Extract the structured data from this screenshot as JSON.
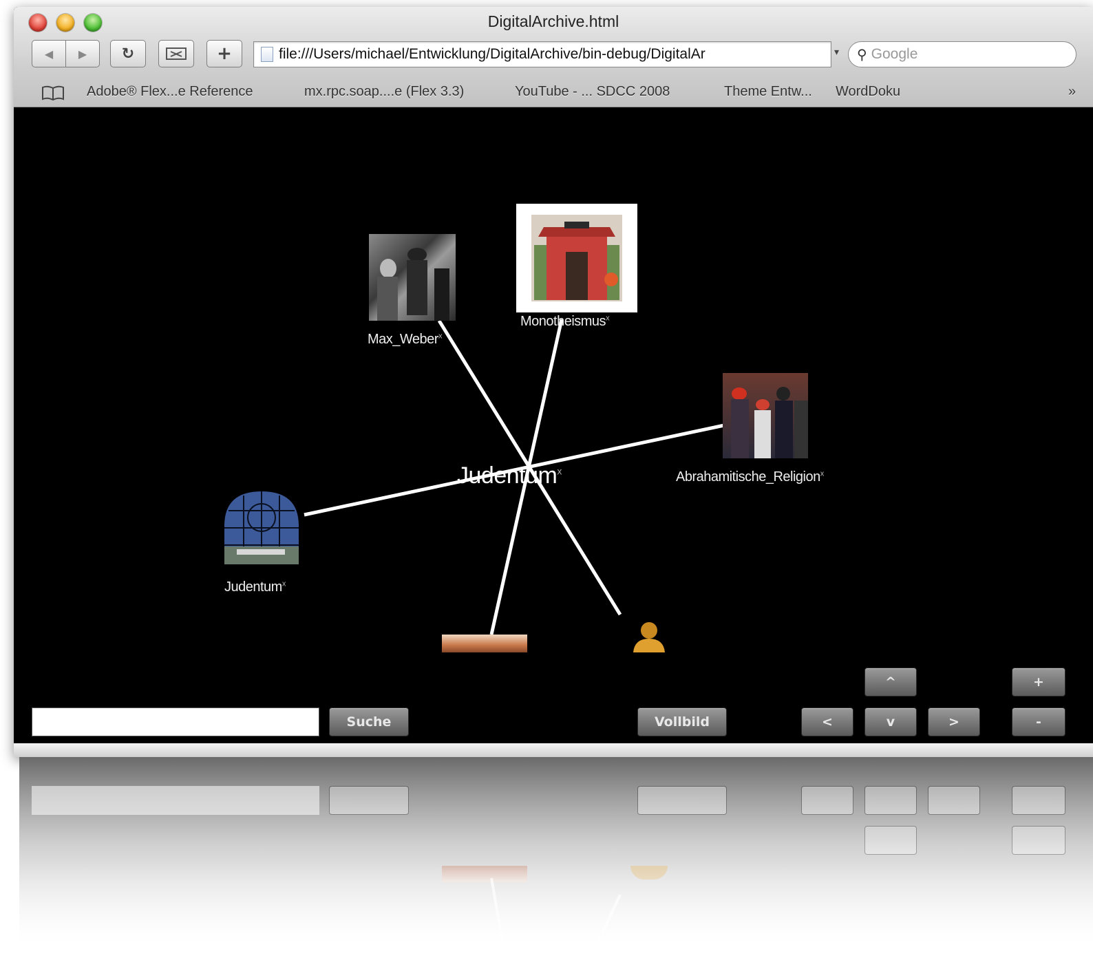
{
  "window": {
    "title": "DigitalArchive.html"
  },
  "toolbar": {
    "back_icon": "◀",
    "forward_icon": "▶",
    "reload_icon": "↻",
    "add_icon": "+",
    "url": "file:///Users/michael/Entwicklung/DigitalArchive/bin-debug/DigitalAr",
    "search_placeholder": "Google"
  },
  "bookmarks": [
    "Adobe® Flex...e Reference",
    "mx.rpc.soap....e (Flex 3.3)",
    "YouTube - ... SDCC 2008",
    "Theme Entw...",
    "WordDoku"
  ],
  "bookmarks_more": "»",
  "graph": {
    "center": {
      "label": "Judentum",
      "mark": "x"
    },
    "nodes": [
      {
        "label": "Max_Weber",
        "mark": "x"
      },
      {
        "label": "Monotheismus",
        "mark": "x"
      },
      {
        "label": "Abrahamitische_Religion",
        "mark": "x"
      },
      {
        "label": "Judentum",
        "mark": "x"
      }
    ]
  },
  "controls": {
    "search_button": "Suche",
    "fullscreen_button": "Vollbild",
    "up_button": "^",
    "down_button": "v",
    "left_button": "<",
    "right_button": ">",
    "zoom_in_button": "+",
    "zoom_out_button": "-"
  },
  "colors": {
    "canvas_background": "#000000",
    "edge": "#ffffff",
    "button_gradient_top": "#9a9a9a",
    "button_gradient_bottom": "#5a5a5a"
  }
}
